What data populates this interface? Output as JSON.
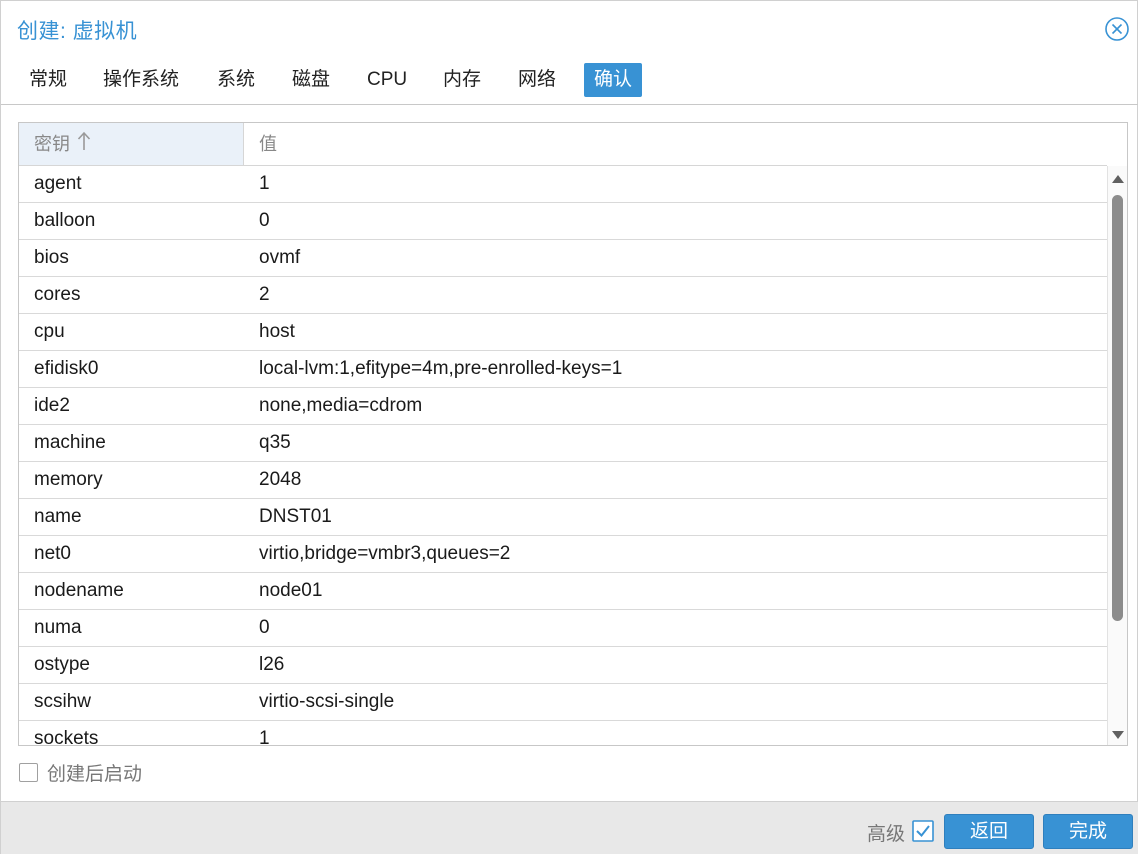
{
  "window": {
    "title": "创建: 虚拟机",
    "close_icon": "close-circle-icon",
    "accent_color": "#3892d4"
  },
  "tabs": [
    {
      "label": "常规",
      "active": false
    },
    {
      "label": "操作系统",
      "active": false
    },
    {
      "label": "系统",
      "active": false
    },
    {
      "label": "磁盘",
      "active": false
    },
    {
      "label": "CPU",
      "active": false
    },
    {
      "label": "内存",
      "active": false
    },
    {
      "label": "网络",
      "active": false
    },
    {
      "label": "确认",
      "active": true
    }
  ],
  "grid": {
    "columns": {
      "key": "密钥",
      "value": "值"
    },
    "sort_icon": "sort-ascending-arrow-icon",
    "rows": [
      {
        "key": "agent",
        "value": "1"
      },
      {
        "key": "balloon",
        "value": "0"
      },
      {
        "key": "bios",
        "value": "ovmf"
      },
      {
        "key": "cores",
        "value": "2"
      },
      {
        "key": "cpu",
        "value": "host"
      },
      {
        "key": "efidisk0",
        "value": "local-lvm:1,efitype=4m,pre-enrolled-keys=1"
      },
      {
        "key": "ide2",
        "value": "none,media=cdrom"
      },
      {
        "key": "machine",
        "value": "q35"
      },
      {
        "key": "memory",
        "value": "2048"
      },
      {
        "key": "name",
        "value": "DNST01"
      },
      {
        "key": "net0",
        "value": "virtio,bridge=vmbr3,queues=2"
      },
      {
        "key": "nodename",
        "value": "node01"
      },
      {
        "key": "numa",
        "value": "0"
      },
      {
        "key": "ostype",
        "value": "l26"
      },
      {
        "key": "scsihw",
        "value": "virtio-scsi-single"
      },
      {
        "key": "sockets",
        "value": "1"
      }
    ]
  },
  "options": {
    "start_after_create_label": "创建后启动",
    "start_after_create_checked": false
  },
  "footer": {
    "advanced_label": "高级",
    "advanced_checked": true,
    "back_label": "返回",
    "finish_label": "完成"
  }
}
